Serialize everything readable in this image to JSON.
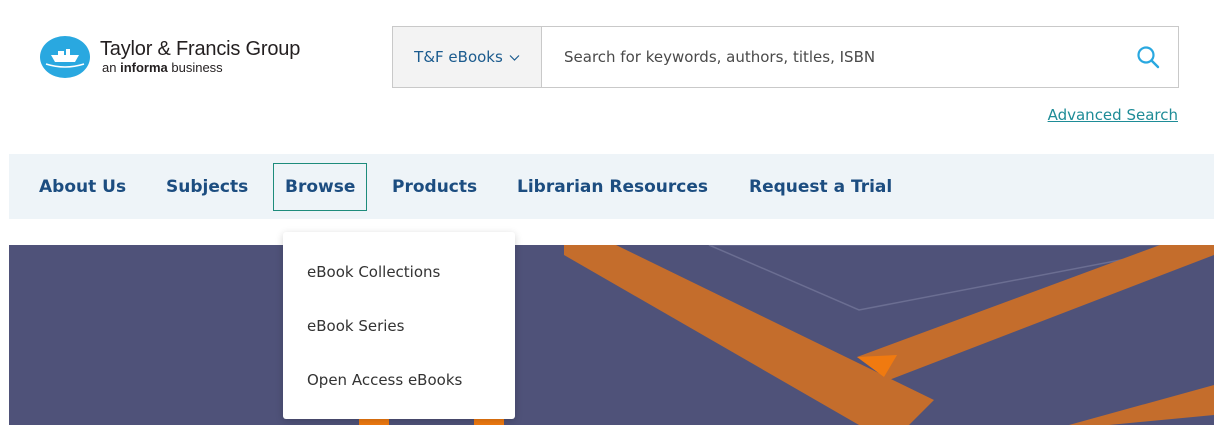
{
  "brand": {
    "title": "Taylor & Francis Group",
    "subtitle_prefix": "an ",
    "subtitle_bold": "informa",
    "subtitle_suffix": " business",
    "icon": "tf-boat-logo-icon",
    "color": "#29a8e0"
  },
  "search": {
    "scope_label": "T&F eBooks",
    "placeholder": "Search for keywords, authors, titles, ISBN",
    "value": "",
    "icon": "search-icon",
    "advanced_label": "Advanced Search"
  },
  "nav": {
    "items": [
      {
        "label": "About Us"
      },
      {
        "label": "Subjects"
      },
      {
        "label": "Browse",
        "active": true
      },
      {
        "label": "Products"
      },
      {
        "label": "Librarian Resources"
      },
      {
        "label": "Request a Trial"
      }
    ]
  },
  "dropdown": {
    "items": [
      {
        "label": "eBook Collections"
      },
      {
        "label": "eBook Series"
      },
      {
        "label": "Open Access eBooks"
      }
    ]
  },
  "colors": {
    "nav_text": "#1c4d80",
    "nav_bg": "#eef4f8",
    "accent": "#1e8c97",
    "banner_bg": "#4f5279",
    "banner_stripe": "#c46d2c"
  }
}
